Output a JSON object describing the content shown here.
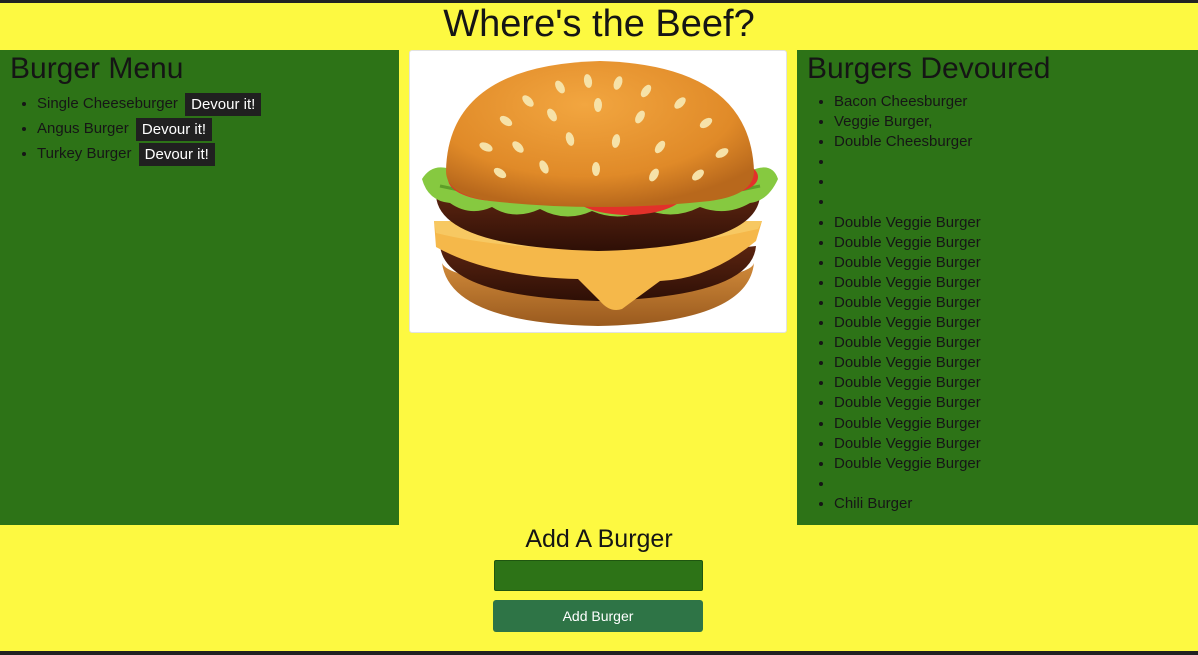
{
  "page": {
    "title": "Where's the Beef?"
  },
  "menu": {
    "heading": "Burger Menu",
    "items": [
      {
        "name": "Single Cheeseburger",
        "button": "Devour it!"
      },
      {
        "name": "Angus Burger",
        "button": "Devour it!"
      },
      {
        "name": "Turkey Burger",
        "button": "Devour it!"
      }
    ]
  },
  "image": {
    "icon": "hamburger-illustration"
  },
  "devoured": {
    "heading": "Burgers Devoured",
    "items": [
      "Bacon Cheesburger",
      "Veggie Burger,",
      "Double Cheesburger",
      "",
      "",
      "",
      "Double Veggie Burger",
      "Double Veggie Burger",
      "Double Veggie Burger",
      "Double Veggie Burger",
      "Double Veggie Burger",
      "Double Veggie Burger",
      "Double Veggie Burger",
      "Double Veggie Burger",
      "Double Veggie Burger",
      "Double Veggie Burger",
      "Double Veggie Burger",
      "Double Veggie Burger",
      "Double Veggie Burger",
      "",
      "Chili Burger"
    ]
  },
  "add_form": {
    "heading": "Add A Burger",
    "input_value": "",
    "button_label": "Add Burger"
  },
  "colors": {
    "page_background": "#fdf941",
    "panel_background": "#2d7317",
    "devour_button": "#202020",
    "add_button": "#2e7446"
  }
}
